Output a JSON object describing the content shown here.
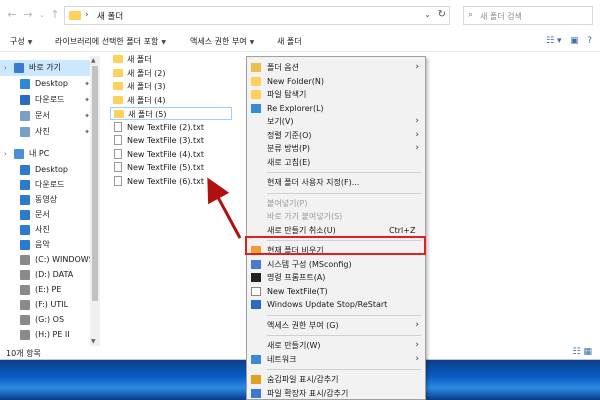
{
  "window": {
    "address_path": "새 폴더",
    "search_placeholder": "새 폴더 검색"
  },
  "commandbar": {
    "items": [
      "구성",
      "라이브러리에 선택한 폴더 포함",
      "액세스 권한 부여",
      "새 폴더"
    ]
  },
  "nav": {
    "quick_access": "바로 가기",
    "items": [
      {
        "label": "Desktop",
        "icon": "desktop-icon",
        "pinned": true
      },
      {
        "label": "다운로드",
        "icon": "download-icon",
        "pinned": true
      },
      {
        "label": "문서",
        "icon": "documents-icon",
        "pinned": true
      },
      {
        "label": "사진",
        "icon": "pictures-icon",
        "pinned": true
      }
    ],
    "this_pc": "내 PC",
    "pc_items": [
      {
        "label": "Desktop",
        "icon": "desktop-icon"
      },
      {
        "label": "다운로드",
        "icon": "download-icon"
      },
      {
        "label": "동영상",
        "icon": "videos-icon"
      },
      {
        "label": "문서",
        "icon": "documents-icon"
      },
      {
        "label": "사진",
        "icon": "pictures-icon"
      },
      {
        "label": "음악",
        "icon": "music-icon"
      },
      {
        "label": "(C:) WINDOWS",
        "icon": "drive-icon"
      },
      {
        "label": "(D:) DATA",
        "icon": "drive-icon"
      },
      {
        "label": "(E:) PE",
        "icon": "drive-icon"
      },
      {
        "label": "(F:) UTIL",
        "icon": "drive-icon"
      },
      {
        "label": "(G:) OS",
        "icon": "drive-icon"
      },
      {
        "label": "(H:) PE II",
        "icon": "drive-icon"
      }
    ]
  },
  "files": [
    {
      "name": "새 폴더",
      "type": "folder"
    },
    {
      "name": "새 폴더 (2)",
      "type": "folder"
    },
    {
      "name": "새 폴더 (3)",
      "type": "folder"
    },
    {
      "name": "새 폴더 (4)",
      "type": "folder"
    },
    {
      "name": "새 폴더 (5)",
      "type": "folder",
      "selected": true
    },
    {
      "name": "New TextFile (2).txt",
      "type": "text"
    },
    {
      "name": "New TextFile (3).txt",
      "type": "text"
    },
    {
      "name": "New TextFile (4).txt",
      "type": "text"
    },
    {
      "name": "New TextFile (5).txt",
      "type": "text"
    },
    {
      "name": "New TextFile (6).txt",
      "type": "text"
    }
  ],
  "status": {
    "item_count": "10개 항목"
  },
  "context_menu": {
    "items": [
      {
        "label": "폴더 옵션",
        "submenu": true,
        "icon": "folder-options-icon"
      },
      {
        "label": "New Folder(N)",
        "icon": "folder-icon"
      },
      {
        "label": "파일 탐색기",
        "icon": "explorer-icon"
      },
      {
        "label": "Re Explorer(L)",
        "icon": "refresh-icon"
      },
      {
        "label": "보기(V)",
        "submenu": true
      },
      {
        "label": "정렬 기준(O)",
        "submenu": true
      },
      {
        "label": "분류 방법(P)",
        "submenu": true
      },
      {
        "label": "새로 고침(E)"
      },
      {
        "sep": true
      },
      {
        "label": "현재 폴더 사용자 지정(F)..."
      },
      {
        "sep": true
      },
      {
        "label": "붙여넣기(P)",
        "disabled": true
      },
      {
        "label": "바로 가기 붙여넣기(S)",
        "disabled": true
      },
      {
        "label": "새로 만들기 취소(U)",
        "shortcut": "Ctrl+Z"
      },
      {
        "sep": true
      },
      {
        "label": "현재 폴더 비우기",
        "icon": "clear-folder-icon",
        "highlighted": true
      },
      {
        "label": "시스템 구성 (MSconfig)",
        "icon": "msconfig-icon"
      },
      {
        "label": "명령 프롬프트(A)",
        "icon": "cmd-icon"
      },
      {
        "label": "New TextFile(T)",
        "icon": "textfile-icon"
      },
      {
        "label": "Windows Update Stop/ReStart",
        "icon": "update-icon"
      },
      {
        "sep": true
      },
      {
        "label": "액세스 권한 부여 (G)",
        "submenu": true
      },
      {
        "sep": true
      },
      {
        "label": "새로 만들기(W)",
        "submenu": true
      },
      {
        "label": "네트워크",
        "submenu": true,
        "icon": "network-icon"
      },
      {
        "sep": true
      },
      {
        "label": "숨김파일 표시/감추기",
        "icon": "hidden-files-icon"
      },
      {
        "label": "파일 확장자 표시/감추기",
        "icon": "extensions-icon"
      }
    ]
  },
  "colors": {
    "highlight_box": "#e0201c",
    "arrow": "#b01010",
    "folder": "#ffd15c",
    "selection": "#cce8ff"
  }
}
